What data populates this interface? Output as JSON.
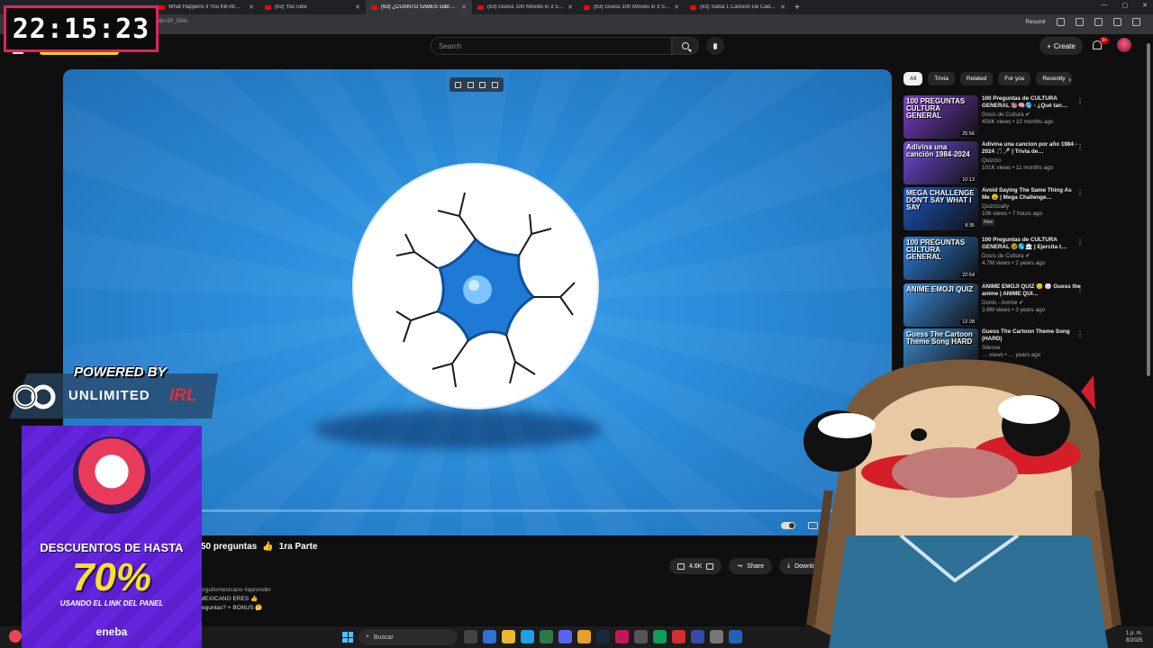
{
  "browser": {
    "tabs": [
      {
        "label": "What Happens if You Kill All…"
      },
      {
        "label": "(63) YouTube"
      },
      {
        "label": "(63) ¿CUÁNTO SABES sobre…",
        "active": true
      },
      {
        "label": "(63) Guess 100 Movies in 3 Secon…"
      },
      {
        "label": "(63) Guess 100 Movies in 3 Secon…"
      },
      {
        "label": "(63) Salva 1 Cancion De Cada Añ…"
      }
    ],
    "url_fragment": "&t=3P_f2i4c",
    "summarize_label": "Resumir"
  },
  "clock": {
    "time": "22:15:23"
  },
  "youtube_header": {
    "search_placeholder": "Search",
    "create_label": "Create",
    "notif_count": "9+"
  },
  "video": {
    "title_tail": "50 preguntas",
    "title_emoji": "👍",
    "title_part": "1ra Parte",
    "likes": "4.6K",
    "share_label": "Share",
    "download_label": "Download",
    "desc_line1": "orgullomexicano #aprender",
    "desc_line2": "MEXICANO ERES 👍",
    "desc_line3": "reguntas? + BONUS 🤔"
  },
  "sidebar": {
    "chips": [
      "All",
      "Trivia",
      "Related",
      "For you",
      "Recently"
    ],
    "recommendations": [
      {
        "thumb_text": "100 PREGUNTAS CULTURA GENERAL",
        "duration": "25:56",
        "title": "100 Preguntas de CULTURA GENERAL 📚🧠🌎 - ¿Qué tan…",
        "channel": "Dosis de Cultura ✔",
        "stats": "458K views • 10 months ago",
        "thumb_color": "#7a3cc8"
      },
      {
        "thumb_text": "Adivina una canción 1984-2024",
        "duration": "10:13",
        "title": "Adivina una cancion por año 1984 - 2024 🎵🎤 | Trivia de…",
        "channel": "Quizzio",
        "stats": "101K views • 11 months ago",
        "thumb_color": "#6f4ad6"
      },
      {
        "thumb_text": "MEGA CHALLENGE DON'T SAY WHAT I SAY",
        "duration": "8:35",
        "title": "Avoid Saying The Same Thing As Me 😮 | Mega Challenge…",
        "channel": "Quizzically",
        "stats": "106 views • 7 hours ago",
        "badge": "New",
        "thumb_color": "#1b58c4"
      },
      {
        "thumb_text": "100 PREGUNTAS CULTURA GENERAL",
        "duration": "22:54",
        "title": "100 Preguntas de CULTURA GENERAL 🤓🌎🏛 | Ejercita t…",
        "channel": "Dosis de Cultura ✔",
        "stats": "4.7M views • 2 years ago",
        "thumb_color": "#2d7fd8"
      },
      {
        "thumb_text": "ANIME EMOJI QUIZ",
        "duration": "12:28",
        "title": "ANIME EMOJI QUIZ 🙂 🍥 Guess the anime | ANIME QUI…",
        "channel": "Donki - Anime ✔",
        "stats": "3.8M views • 3 years ago",
        "thumb_color": "#3b8ee0"
      },
      {
        "thumb_text": "Guess The Cartoon Theme Song HARD",
        "duration": "",
        "title": "Guess The Cartoon Theme Song (HARD)",
        "channel": "Silense",
        "stats": "… views • … years ago",
        "thumb_color": "#3d8bd0"
      }
    ]
  },
  "overlay": {
    "powered_by": "POWERED BY",
    "unlimited": "UNLIMITED",
    "irl": "IRL"
  },
  "ad": {
    "headline": "DESCUENTOS DE HASTA",
    "percent": "70%",
    "sub": "USANDO EL LINK DEL PANEL",
    "brand": "eneba"
  },
  "taskbar": {
    "search_placeholder": "Buscar",
    "time": "1 p. m.",
    "date": "8/2025"
  },
  "colors": {
    "accent_red": "#e0245e",
    "youtube_red": "#ff0000",
    "clock_deco": "#f7d31c",
    "ad_purple": "#5b1fd0"
  }
}
